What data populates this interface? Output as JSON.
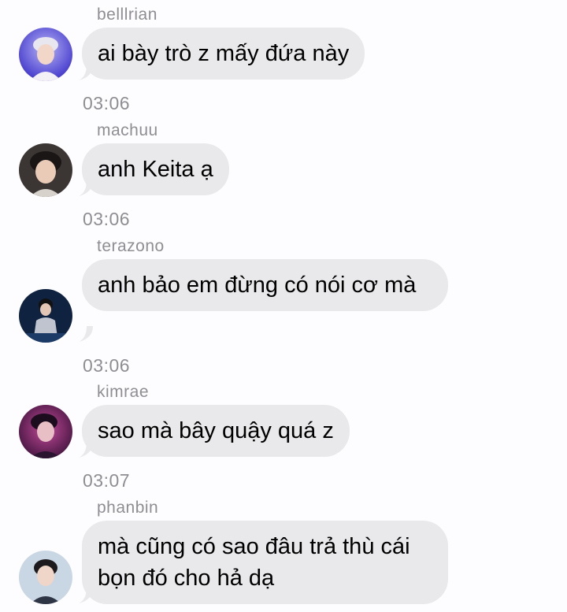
{
  "messages": [
    {
      "username": "belllrian",
      "text": "ai bày trò z mấy đứa này",
      "avatar_icon": "user-avatar-icon"
    },
    {
      "username": "machuu",
      "text": "anh Keita ạ",
      "avatar_icon": "user-avatar-icon"
    },
    {
      "username": "terazono",
      "text": "anh bảo em đừng có nói cơ mà",
      "avatar_icon": "user-avatar-icon"
    },
    {
      "username": "kimrae",
      "text": "sao mà bây quậy quá z",
      "avatar_icon": "user-avatar-icon"
    },
    {
      "username": "phanbin",
      "text": "mà cũng có sao đâu trả thù cái bọn đó cho hả dạ",
      "avatar_icon": "user-avatar-icon"
    }
  ],
  "timestamps": [
    "03:06",
    "03:06",
    "03:06",
    "03:07"
  ],
  "colors": {
    "background": "#fdfcfe",
    "bubble": "#e9e9eb",
    "meta_text": "#8e8e93",
    "message_text": "#000000"
  }
}
